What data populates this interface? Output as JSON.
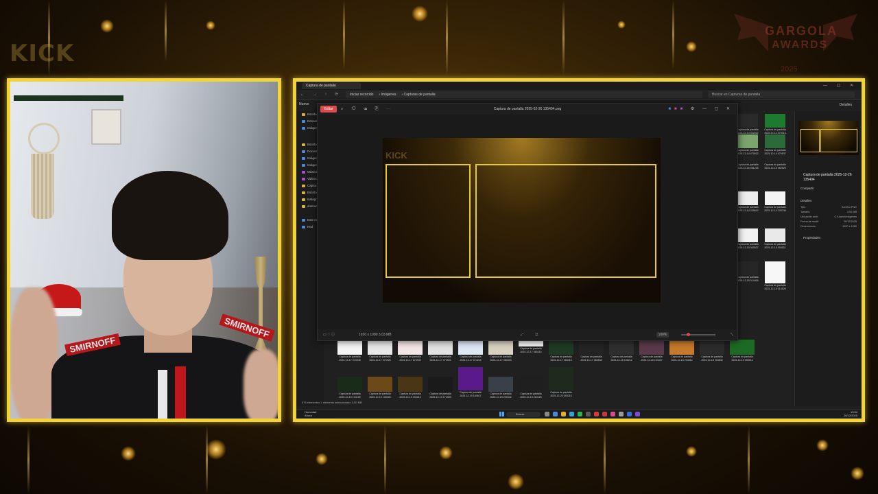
{
  "overlay": {
    "kick_logo": "KICK",
    "event_logo": {
      "line1": "GARGOLA",
      "line2": "AWARDS",
      "year": "2025"
    }
  },
  "webcam": {
    "shirt_text_left": "SMIRNOFF",
    "shirt_text_right": "SMIRNOFF"
  },
  "explorer": {
    "tab_title": "Captura de pantalla",
    "breadcrumbs": [
      "Iniciar recorrido",
      "Imágenes",
      "Capturas de pantalla"
    ],
    "search_placeholder": "Buscar en Capturas de pantalla",
    "new_label": "Nuevo",
    "details_label": "Detalles",
    "sidebar_items": [
      {
        "label": "Escritorio",
        "color": "yellow"
      },
      {
        "label": "Descargas",
        "color": "blue"
      },
      {
        "label": "Imágenes",
        "color": "blue"
      },
      {
        "label": "Escritorio",
        "color": "yellow"
      },
      {
        "label": "Documentos",
        "color": "blue"
      },
      {
        "label": "Imágenes",
        "color": "blue"
      },
      {
        "label": "Imágenes",
        "color": "blue"
      },
      {
        "label": "Música",
        "color": "purple"
      },
      {
        "label": "Videos",
        "color": "purple"
      },
      {
        "label": "Capturas",
        "color": "yellow"
      },
      {
        "label": "Escritorio",
        "color": "yellow"
      },
      {
        "label": "Instagram",
        "color": "yellow"
      },
      {
        "label": "animaciones",
        "color": "yellow"
      },
      {
        "label": "Este equipo",
        "color": "blue"
      },
      {
        "label": "Red",
        "color": "blue"
      }
    ],
    "status": "576 elementos   1 elemento seleccionado  3,00 MB",
    "details": {
      "name": "Captura de pantalla 2025-12-26 135404",
      "share": "Compartir",
      "heading": "Detalles",
      "rows": [
        {
          "k": "Tipo",
          "v": "Archivo PNG"
        },
        {
          "k": "Tamaño",
          "v": "3,00 MB"
        },
        {
          "k": "Ubicación arch.",
          "v": "C:\\Users\\Imágenes"
        },
        {
          "k": "Fecha de modif.",
          "v": "26/12/2025"
        },
        {
          "k": "Dimensiones",
          "v": "1920 x 1080"
        }
      ],
      "properties": "Propiedades"
    },
    "grid_row1": [
      "Captura de pantalla 2025-12-17 073948",
      "Captura de pantalla 2025-12-17 073926",
      "Captura de pantalla 2025-12-17 073939",
      "Captura de pantalla 2025-12-17 073924",
      "Captura de pantalla 2025-12-17 074215",
      "Captura de pantalla 2025-12-17 080303",
      "Captura de pantalla 2025-12-17 080215",
      "Captura de pantalla 2025-12-17 084415",
      "Captura de pantalla 2025-12-17 084633",
      "Captura de pantalla 2025-12-18 105212",
      "Captura de pantalla 2025-12-18 104427",
      "Captura de pantalla 2025-12-18 204812",
      "Captura de pantalla 2025-12-18 204844",
      "Captura de pantalla 2025-12-19 095012"
    ],
    "grid_row2": [
      "Captura de pantalla 2025-12-19 104109",
      "Captura de pantalla 2025-12-19 130020",
      "Captura de pantalla 2025-12-19 153213",
      "Captura de pantalla 2025-12-19 171509",
      "Captura de pantalla 2025-12-19 184817",
      "Captura de pantalla 2025-12-19 200342",
      "Captura de pantalla 2025-12-19 210125",
      "Captura de pantalla 2025-12-20 093210"
    ],
    "right_thumbs": [
      "Captura de pantalla 2025-12-14 042547",
      "Captura de pantalla 2025-12-14 070013",
      "Captura de pantalla 2025-12-14 070522",
      "Captura de pantalla 2025-12-14 070537",
      "Captura de pantalla 2025-12-14 235613",
      "Captura de pantalla 2025-12-14 235748",
      "Captura de pantalla 2025-12-15 000527",
      "Captura de pantalla 2025-12-15 000521",
      "Captura de pantalla 2025-12-15 014409",
      "Captura de pantalla 2025-12-15 014529",
      "Captura de pantalla 2025-12-16 081226",
      "Captura de pantalla 2025-12-16 082629"
    ]
  },
  "viewer": {
    "edit_label": "Editar",
    "title": "Captura de pantalla 2025-02-26 135404.png",
    "info": "1920 x 1080    3,03 MB",
    "zoom": "100%",
    "preview_logo": "KICK"
  },
  "taskbar": {
    "weather_temp": "Humedad",
    "weather_sub": "Ahora",
    "search": "Buscar",
    "time": "13:54",
    "date": "26/12/2025"
  }
}
